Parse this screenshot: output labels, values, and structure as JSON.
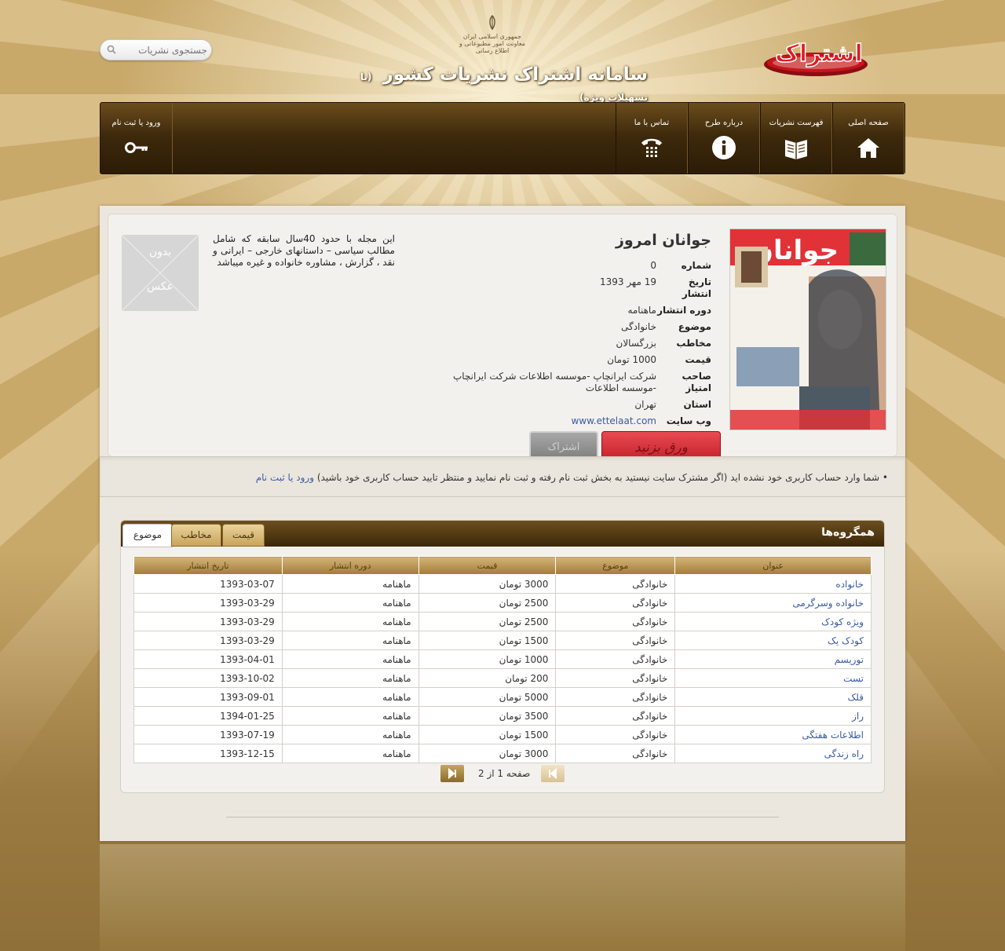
{
  "header": {
    "search_placeholder": "جستجوی نشریات",
    "emblem_text": [
      "جمهوری اسلامی ایران",
      "معاونت امور مطبوعاتی و اطلاع رسانی"
    ],
    "site_title": "سامانه اشتراک نشریات کشور",
    "site_subtitle": "(با تسهیلات ویژه)",
    "logo_text": "اشتراک"
  },
  "nav": {
    "items": [
      {
        "label": "صفحه اصلی",
        "icon": "home-icon"
      },
      {
        "label": "فهرست نشریات",
        "icon": "book-icon"
      },
      {
        "label": "درباره طرح",
        "icon": "info-icon"
      },
      {
        "label": "تماس با ما",
        "icon": "phone-icon"
      }
    ],
    "login": {
      "label": "ورود یا ثبت نام",
      "icon": "key-icon"
    }
  },
  "magazine": {
    "title": "جوانان امروز",
    "fields": [
      {
        "key": "شماره",
        "value": "0"
      },
      {
        "key": "تاریخ انتشار",
        "value": "19 مهر 1393"
      },
      {
        "key": "دوره انتشار",
        "value": "ماهنامه"
      },
      {
        "key": "موضوع",
        "value": "خانوادگی"
      },
      {
        "key": "مخاطب",
        "value": "بزرگسالان"
      },
      {
        "key": "قیمت",
        "value": "1000 تومان"
      },
      {
        "key": "صاحب امتیاز",
        "value": "شرکت ایرانچاپ -موسسه اطلاعات شرکت ایرانچاپ -موسسه اطلاعات"
      },
      {
        "key": "استان",
        "value": "تهران"
      },
      {
        "key": "وب سایت",
        "value": "www.ettelaat.com"
      }
    ],
    "description": "این مجله با حدود 40سال سابقه که شامل مطالب سیاسی – داستانهای خارجی – ایرانی و نقد ، گزارش ، مشاوره خانواده و غیره میباشد",
    "no_image_line1": "بدون",
    "no_image_line2": "عکس",
    "cover_masthead": "جوانان",
    "read_button": "ورق بزنید",
    "subscribe_button": "اشتراک"
  },
  "notice": {
    "text": "شما وارد حساب کاربری خود نشده اید (اگر مشترک سایت نیستید به بخش ثبت نام رفته و ثبت نام نمایید و منتظر تایید حساب کاربری خود باشید)",
    "link": "ورود یا ثبت نام"
  },
  "group": {
    "title": "همگروه‌ها",
    "tabs": [
      "موضوع",
      "مخاطب",
      "قیمت"
    ],
    "columns": [
      "عنوان",
      "موضوع",
      "قیمت",
      "دوره انتشار",
      "تاریخ انتشار"
    ],
    "rows": [
      [
        "خانواده",
        "خانوادگی",
        "3000 تومان",
        "ماهنامه",
        "1393-03-07"
      ],
      [
        "خانواده وسرگرمی",
        "خانوادگی",
        "2500 تومان",
        "ماهنامه",
        "1393-03-29"
      ],
      [
        "ویژه کودک",
        "خانوادگی",
        "2500 تومان",
        "ماهنامه",
        "1393-03-29"
      ],
      [
        "کودک یک",
        "خانوادگی",
        "1500 تومان",
        "ماهنامه",
        "1393-03-29"
      ],
      [
        "توریسم",
        "خانوادگی",
        "1000 تومان",
        "ماهنامه",
        "1393-04-01"
      ],
      [
        "تست",
        "خانوادگی",
        "200 تومان",
        "ماهنامه",
        "1393-10-02"
      ],
      [
        "قلک",
        "خانوادگی",
        "5000 تومان",
        "ماهنامه",
        "1393-09-01"
      ],
      [
        "راز",
        "خانوادگی",
        "3500 تومان",
        "ماهنامه",
        "1394-01-25"
      ],
      [
        "اطلاعات هفتگی",
        "خانوادگی",
        "1500 تومان",
        "ماهنامه",
        "1393-07-19"
      ],
      [
        "راه زندگی",
        "خانوادگی",
        "3000 تومان",
        "ماهنامه",
        "1393-12-15"
      ]
    ],
    "pager": "صفحه 1 از 2"
  }
}
